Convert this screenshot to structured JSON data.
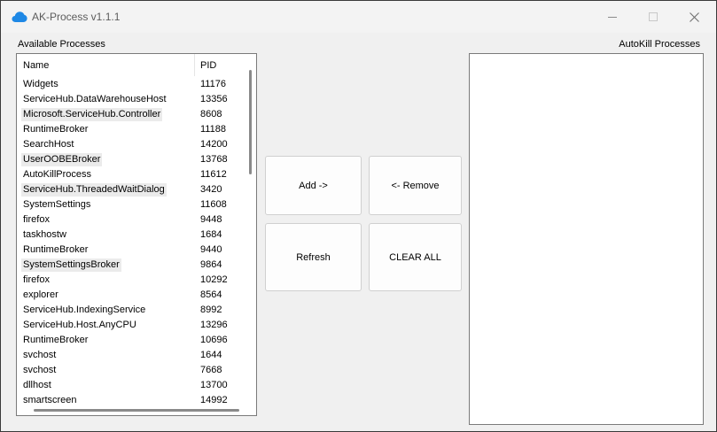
{
  "window": {
    "title": "AK-Process v1.1.1",
    "app_icon": "cloud-icon",
    "controls": [
      "minimize-icon",
      "maximize-icon",
      "close-icon"
    ]
  },
  "available": {
    "label": "Available Processes",
    "columns": {
      "name": "Name",
      "pid": "PID"
    },
    "rows": [
      {
        "name": "Widgets",
        "pid": "11176",
        "highlighted": false
      },
      {
        "name": "ServiceHub.DataWarehouseHost",
        "pid": "13356",
        "highlighted": false
      },
      {
        "name": "Microsoft.ServiceHub.Controller",
        "pid": "8608",
        "highlighted": true
      },
      {
        "name": "RuntimeBroker",
        "pid": "11188",
        "highlighted": false
      },
      {
        "name": "SearchHost",
        "pid": "14200",
        "highlighted": false
      },
      {
        "name": "UserOOBEBroker",
        "pid": "13768",
        "highlighted": true
      },
      {
        "name": "AutoKillProcess",
        "pid": "11612",
        "highlighted": false
      },
      {
        "name": "ServiceHub.ThreadedWaitDialog",
        "pid": "3420",
        "highlighted": true
      },
      {
        "name": "SystemSettings",
        "pid": "11608",
        "highlighted": false
      },
      {
        "name": "firefox",
        "pid": "9448",
        "highlighted": false
      },
      {
        "name": "taskhostw",
        "pid": "1684",
        "highlighted": false
      },
      {
        "name": "RuntimeBroker",
        "pid": "9440",
        "highlighted": false
      },
      {
        "name": "SystemSettingsBroker",
        "pid": "9864",
        "highlighted": true
      },
      {
        "name": "firefox",
        "pid": "10292",
        "highlighted": false
      },
      {
        "name": "explorer",
        "pid": "8564",
        "highlighted": false
      },
      {
        "name": "ServiceHub.IndexingService",
        "pid": "8992",
        "highlighted": false
      },
      {
        "name": "ServiceHub.Host.AnyCPU",
        "pid": "13296",
        "highlighted": false
      },
      {
        "name": "RuntimeBroker",
        "pid": "10696",
        "highlighted": false
      },
      {
        "name": "svchost",
        "pid": "1644",
        "highlighted": false
      },
      {
        "name": "svchost",
        "pid": "7668",
        "highlighted": false
      },
      {
        "name": "dllhost",
        "pid": "13700",
        "highlighted": false
      },
      {
        "name": "smartscreen",
        "pid": "14992",
        "highlighted": false
      }
    ]
  },
  "buttons": {
    "add": "Add ->",
    "remove": "<- Remove",
    "refresh": "Refresh",
    "clear_all": "CLEAR ALL"
  },
  "autokill": {
    "label": "AutoKill Processes",
    "items": []
  },
  "colors": {
    "accent": "#1e88e5",
    "window_bg": "#f0f0f0",
    "row_highlight": "#ebebeb"
  }
}
